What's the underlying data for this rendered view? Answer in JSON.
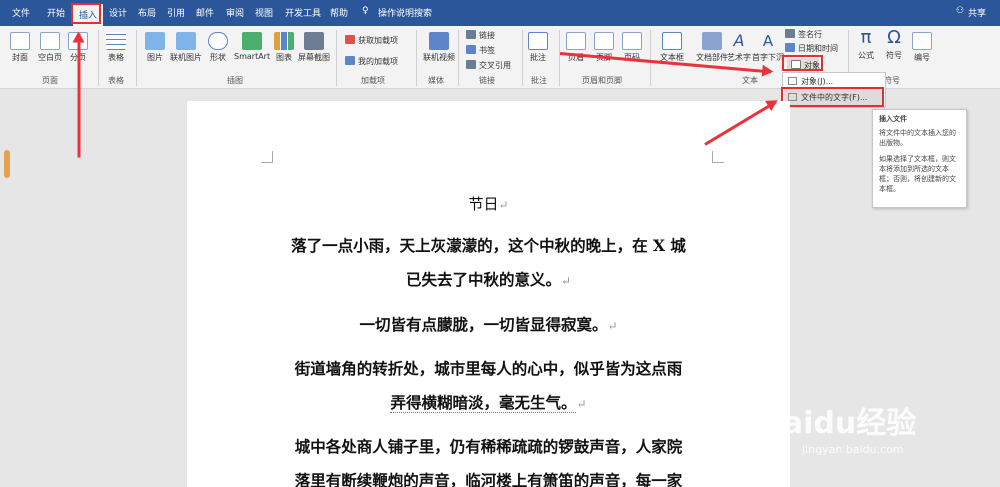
{
  "tabs": [
    "文件",
    "开始",
    "插入",
    "设计",
    "布局",
    "引用",
    "邮件",
    "审阅",
    "视图",
    "开发工具",
    "帮助"
  ],
  "tell_me": "操作说明搜索",
  "share": "共享",
  "ribbon": {
    "pages": [
      "封面",
      "空白页",
      "分页"
    ],
    "pages_group": "页面",
    "table": "表格",
    "table_group": "表格",
    "illus": [
      "图片",
      "联机图片",
      "形状",
      "SmartArt",
      "图表",
      "屏幕截图"
    ],
    "illus_group": "插图",
    "addins": [
      "获取加载项",
      "我的加载项"
    ],
    "addins_group": "加载项",
    "media": "联机视频",
    "media_group": "媒体",
    "links": [
      "链接",
      "书签",
      "交叉引用"
    ],
    "links_group": "链接",
    "comment": "批注",
    "comment_group": "批注",
    "hf": [
      "页眉",
      "页脚",
      "页码"
    ],
    "hf_group": "页眉和页脚",
    "text": [
      "文本框",
      "文档部件",
      "艺术字",
      "首字下沉"
    ],
    "text_small": [
      "签名行",
      "日期和时间"
    ],
    "text_group": "文本",
    "symbols": [
      "公式",
      "符号",
      "编号"
    ],
    "symbols_group": "符号"
  },
  "object_menu": {
    "button": "对象",
    "items": [
      "对象(J)...",
      "文件中的文字(F)..."
    ]
  },
  "tooltip": {
    "title": "插入文件",
    "line1": "将文件中的文本插入您的出版物。",
    "line2": "如果选择了文本框，则文本将添加到所选的文本框；否则，将创建新的文本框。"
  },
  "document": {
    "title": "节日",
    "p1a": "落了一点小雨，天上灰濛濛的，这个中秋的晚上，在 X 城",
    "p1b": "已失去了中秋的意义。",
    "p2": "一切皆有点朦胧，一切皆显得寂寞。",
    "p3a": "街道墙角的转折处，城市里每人的心中，似乎皆为这点雨",
    "p3b": "弄得横糊暗淡，毫无生气。",
    "p4a": "城中各处商人铺子里，仍有稀稀疏疏的锣鼓声音，人家院",
    "p4b": "落里有断续鞭炮的声音，临河楼上有箫笛的声音，每一家",
    "return_mark": "↵"
  },
  "watermark": {
    "brand": "Baidu经验",
    "url": "jingyan.baidu.com"
  },
  "colors": {
    "tabbar": "#2b579a",
    "ribbon": "#f3f3f3",
    "arrow": "#e8323c",
    "highlight_box": "#e03030"
  }
}
